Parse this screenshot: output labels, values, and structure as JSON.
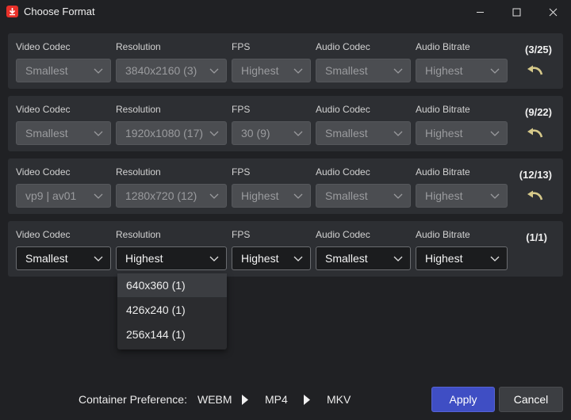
{
  "window": {
    "title": "Choose Format",
    "minimize_glyph": "—",
    "maximize_glyph": "☐",
    "close_glyph": "✕"
  },
  "labels": {
    "video_codec": "Video Codec",
    "resolution": "Resolution",
    "fps": "FPS",
    "audio_codec": "Audio Codec",
    "audio_bitrate": "Audio Bitrate"
  },
  "rows": [
    {
      "video_codec": "Smallest",
      "resolution": "3840x2160 (3)",
      "fps": "Highest",
      "audio_codec": "Smallest",
      "audio_bitrate": "Highest",
      "count": "(3/25)"
    },
    {
      "video_codec": "Smallest",
      "resolution": "1920x1080 (17)",
      "fps": "30 (9)",
      "audio_codec": "Smallest",
      "audio_bitrate": "Highest",
      "count": "(9/22)"
    },
    {
      "video_codec": "vp9 | av01",
      "resolution": "1280x720 (12)",
      "fps": "Highest",
      "audio_codec": "Smallest",
      "audio_bitrate": "Highest",
      "count": "(12/13)"
    },
    {
      "video_codec": "Smallest",
      "resolution": "Highest",
      "fps": "Highest",
      "audio_codec": "Smallest",
      "audio_bitrate": "Highest",
      "count": "(1/1)"
    }
  ],
  "dropdown": {
    "options": [
      "640x360 (1)",
      "426x240 (1)",
      "256x144 (1)"
    ],
    "highlighted_index": 0
  },
  "footer": {
    "container_label": "Container Preference:",
    "containers": [
      "WEBM",
      "MP4",
      "MKV"
    ],
    "apply_label": "Apply",
    "cancel_label": "Cancel"
  },
  "colors": {
    "accent": "#3f4ec4",
    "undo_icon": "#d6c98a",
    "app_icon": "#e8312a"
  },
  "icons": {
    "app": "download-icon",
    "undo": "undo-icon",
    "chevron": "chevron-down-icon",
    "arrow": "arrow-right-icon"
  }
}
